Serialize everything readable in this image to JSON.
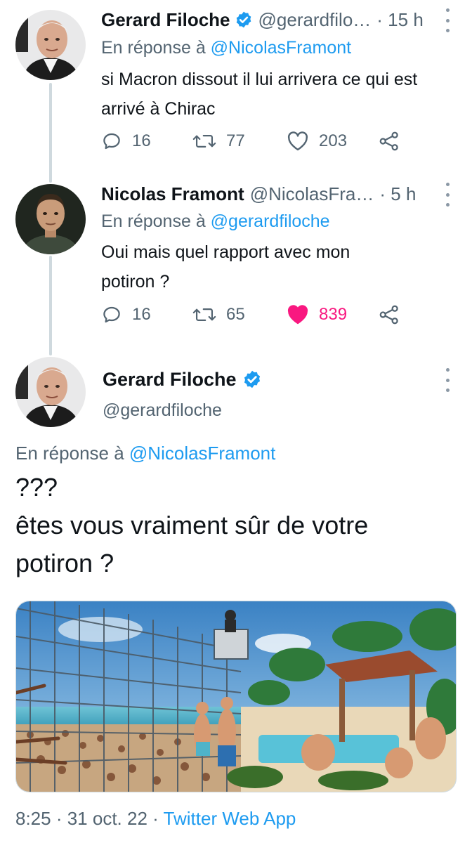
{
  "thread": [
    {
      "author": {
        "name": "Gerard Filoche",
        "handle": "@gerardfilo…",
        "verified": true
      },
      "time": "· 15 h",
      "reply_prefix": "En réponse à",
      "reply_to": "@NicolasFramont",
      "text_lines": [
        "si Macron dissout il lui arrivera ce qui est",
        "arrivé à Chirac"
      ],
      "replies": "16",
      "retweets": "77",
      "likes": "203",
      "liked": false
    },
    {
      "author": {
        "name": "Nicolas Framont",
        "handle": "@NicolasFra…",
        "verified": false
      },
      "time": "· 5 h",
      "reply_prefix": "En réponse à",
      "reply_to": "@gerardfiloche",
      "text_lines": [
        "Oui mais quel rapport avec mon",
        "potiron ?"
      ],
      "replies": "16",
      "retweets": "65",
      "likes": "839",
      "liked": true
    }
  ],
  "main_tweet": {
    "author": {
      "name": "Gerard Filoche",
      "handle": "@gerardfiloche",
      "verified": true
    },
    "reply_prefix": "En réponse à",
    "reply_to": "@NicolasFramont",
    "text_lines": [
      "???",
      "êtes vous vraiment sûr de votre",
      "potiron ?"
    ],
    "timestamp": "8:25 · 31 oct. 22 · ",
    "source_app": "Twitter Web App"
  },
  "colors": {
    "accent": "#1d9bf0",
    "like": "#f91880",
    "secondary_text": "#536471",
    "thread_line": "#cfd9de"
  },
  "icons": [
    "reply-icon",
    "retweet-icon",
    "like-icon",
    "share-icon",
    "verified-badge-icon",
    "more-icon"
  ]
}
